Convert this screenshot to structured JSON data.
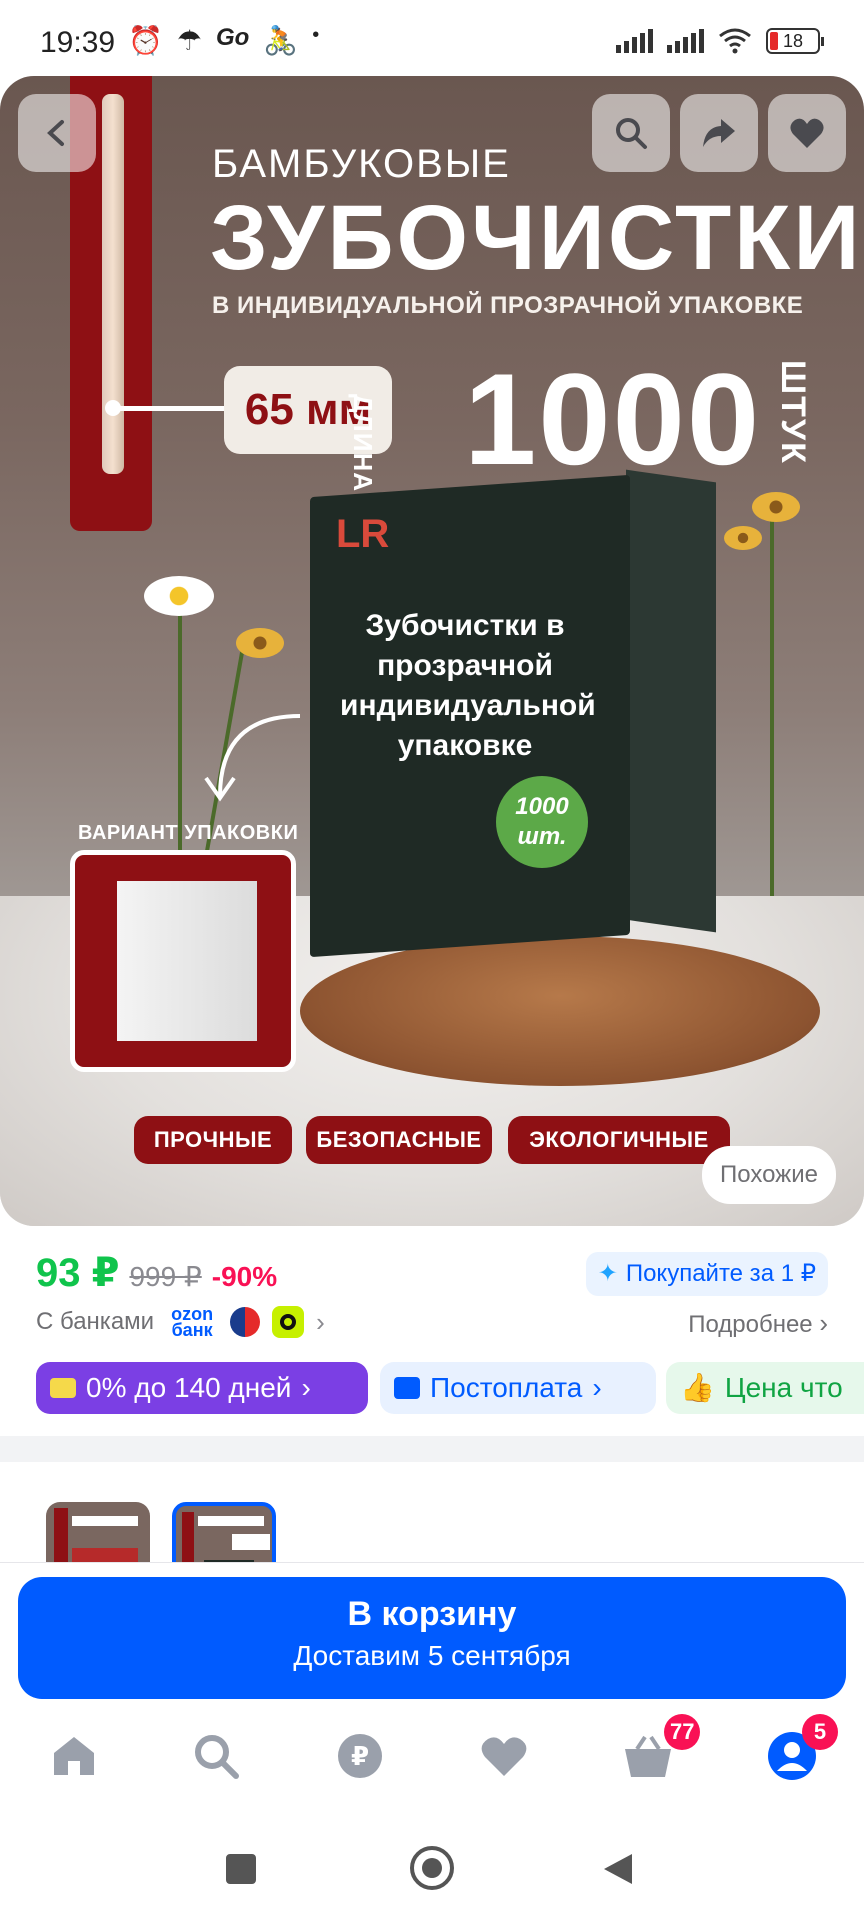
{
  "status_bar": {
    "time": "19:39",
    "battery": "18"
  },
  "hero": {
    "title_small": "БАМБУКОВЫЕ",
    "title_big": "ЗУБОЧИСТКИ",
    "subtitle": "В ИНДИВИДУАЛЬНОЙ ПРОЗРАЧНОЙ УПАКОВКЕ",
    "length_value": "65 мм",
    "length_label": "ДЛИНА",
    "count_value": "1000",
    "count_unit": "ШТУК",
    "box_logo": "LR",
    "box_text": "Зубочистки в прозрачной индивидуальной упаковке",
    "box_badge": "1000 шт.",
    "variant_label": "ВАРИАНТ УПАКОВКИ",
    "chips": [
      "ПРОЧНЫЕ",
      "БЕЗОПАСНЫЕ",
      "ЭКОЛОГИЧНЫЕ"
    ],
    "similar_label": "Похожие"
  },
  "price": {
    "current": "93 ₽",
    "old": "999 ₽",
    "discount": "-90%",
    "buy_for_one": "Покупайте за 1 ₽",
    "banks_label": "С банками",
    "ozon_bank": "ozon банк",
    "details_label": "Подробнее"
  },
  "pills": {
    "installment": "0% до 140 дней",
    "postpay": "Постоплата",
    "price_note": "Цена что"
  },
  "cart": {
    "label": "В корзину",
    "delivery": "Доставим 5 сентября"
  },
  "tabbar": {
    "cart_badge": "77",
    "profile_badge": "5"
  },
  "colors": {
    "accent": "#005bff",
    "price": "#10c44c",
    "discount": "#f91155",
    "brand_red": "#8e1014"
  }
}
